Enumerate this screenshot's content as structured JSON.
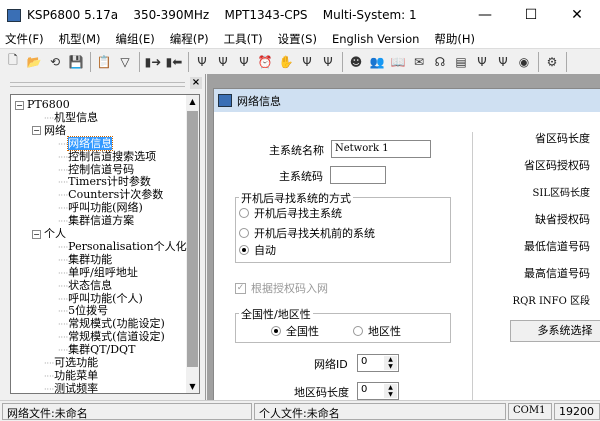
{
  "window": {
    "title": "KSP6800 5.17a    350-390MHz    MPT1343-CPS    Multi-System: 1",
    "minimize": "—",
    "maximize": "☐",
    "close": "✕"
  },
  "menu": [
    "文件(F)",
    "机型(M)",
    "编组(E)",
    "编程(P)",
    "工具(T)",
    "设置(S)",
    "English Version",
    "帮助(H)"
  ],
  "toolbar": {
    "groups": [
      [
        "new-icon",
        "open-icon",
        "read-icon",
        "save-icon"
      ],
      [
        "clipboard-icon",
        "filter-icon"
      ],
      [
        "radio-read-icon",
        "radio-write-icon"
      ],
      [
        "antenna-icon",
        "antenna-h-icon",
        "antenna-ch-icon",
        "alarm-clock-icon",
        "hand-icon",
        "antenna-signal-icon",
        "antenna-bars-icon"
      ],
      [
        "person-icon",
        "users-icon",
        "book-icon",
        "mail-icon",
        "voice-icon",
        "chart-icon",
        "wrench-icon",
        "wrench-bars-icon",
        "sound-icon"
      ],
      [
        "gears-icon"
      ]
    ]
  },
  "tree": {
    "close": "×",
    "items": [
      {
        "label": "PT6800",
        "level": 0,
        "exp": "−"
      },
      {
        "label": "机型信息",
        "level": 1
      },
      {
        "label": "网络",
        "level": 1,
        "exp": "−"
      },
      {
        "label": "网络信息",
        "level": 2,
        "selected": true
      },
      {
        "label": "控制信道搜索选项",
        "level": 2
      },
      {
        "label": "控制信道号码",
        "level": 2
      },
      {
        "label": "Timers计时参数",
        "level": 2
      },
      {
        "label": "Counters计次参数",
        "level": 2
      },
      {
        "label": "呼叫功能(网络)",
        "level": 2
      },
      {
        "label": "集群信道方案",
        "level": 2
      },
      {
        "label": "个人",
        "level": 1,
        "exp": "−"
      },
      {
        "label": "Personalisation个人化",
        "level": 2
      },
      {
        "label": "集群功能",
        "level": 2
      },
      {
        "label": "单呼/组呼地址",
        "level": 2
      },
      {
        "label": "状态信息",
        "level": 2
      },
      {
        "label": "呼叫功能(个人)",
        "level": 2
      },
      {
        "label": "5位拨号",
        "level": 2
      },
      {
        "label": "常规模式(功能设定)",
        "level": 2
      },
      {
        "label": "常规模式(信道设定)",
        "level": 2
      },
      {
        "label": "集群QT/DQT",
        "level": 2
      },
      {
        "label": "可选功能",
        "level": 1
      },
      {
        "label": "功能菜单",
        "level": 1
      },
      {
        "label": "测试频率",
        "level": 1
      }
    ]
  },
  "child": {
    "title": "网络信息",
    "main_name_label": "主系统名称",
    "main_name_value": "Network 1",
    "main_code_label": "主系统码",
    "main_code_value": "",
    "search_group": "开机后寻找系统的方式",
    "search_options": [
      "开机后寻找主系统",
      "开机后寻找关机前的系统",
      "自动"
    ],
    "search_selected": 2,
    "auth_checkbox": "根据授权码入网",
    "auth_checked": true,
    "scope_group": "全国性/地区性",
    "scope_options": [
      "全国性",
      "地区性"
    ],
    "scope_selected": 0,
    "net_id_label": "网络ID",
    "net_id_value": "0",
    "area_len_label": "地区码长度",
    "area_len_value": "0",
    "right_labels": [
      "省区码长度",
      "省区码授权码",
      "SIL区码长度",
      "缺省授权码",
      "最低信道号码",
      "最高信道号码",
      "RQR INFO 区段"
    ],
    "multi_button": "多系统选择"
  },
  "status": {
    "net_file": "网络文件:未命名",
    "personal_file": "个人文件:未命名",
    "port": "COM1",
    "baud": "19200"
  }
}
